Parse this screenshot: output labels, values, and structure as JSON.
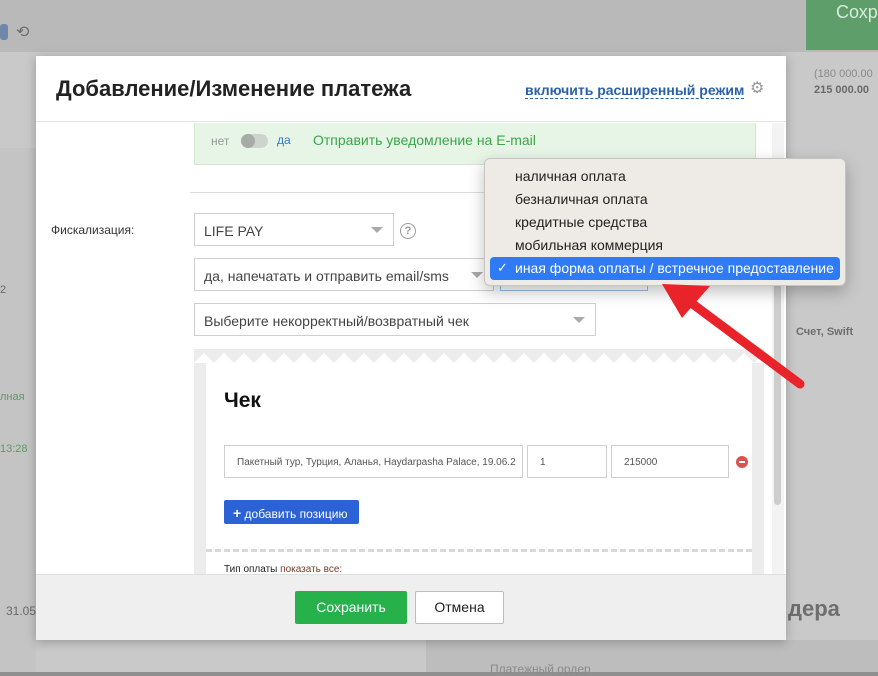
{
  "background": {
    "save_label": "Сохр",
    "amount_secondary": "(180 000.00",
    "amount_primary": "215 000.00",
    "account_label": "Счет, Swift",
    "left_status": "лная",
    "left_time": "13:28",
    "left_date": "31.05",
    "left_char": "2",
    "right_heading": "дера",
    "bottom_text": "Платежный ордер"
  },
  "modal": {
    "title": "Добавление/Изменение платежа",
    "advanced_mode_link": "включить расширенный режим",
    "notify": {
      "no_label": "нет",
      "yes_label": "да",
      "label": "Отправить уведомление на E-mail"
    },
    "fiscalization": {
      "label": "Фискализация:",
      "provider": "LIFE PAY",
      "print_option": "да, напечатать и отправить email/sms",
      "incorrect_receipt_placeholder": "Выберите некорректный/возвратный чек"
    },
    "receipt": {
      "title": "Чек",
      "item_name": "Пакетный тур, Турция, Аланья, Haydarpasha Palace, 19.06.2",
      "quantity": "1",
      "price": "215000",
      "add_position_label": "добавить позицию",
      "payment_type_label": "Тип оплаты",
      "show_all_link": "показать все:"
    },
    "footer": {
      "save_label": "Сохранить",
      "cancel_label": "Отмена"
    }
  },
  "dropdown": {
    "options": [
      "наличная оплата",
      "безналичная оплата",
      "кредитные средства",
      "мобильная коммерция",
      "иная форма оплаты / встречное предоставление"
    ],
    "selected_check": "✓"
  },
  "colors": {
    "accent_blue": "#2b63d6",
    "save_green": "#27b14b",
    "highlight_blue": "#2f7bf5",
    "arrow_red": "#e8232a",
    "notify_green": "#3ba54a"
  }
}
